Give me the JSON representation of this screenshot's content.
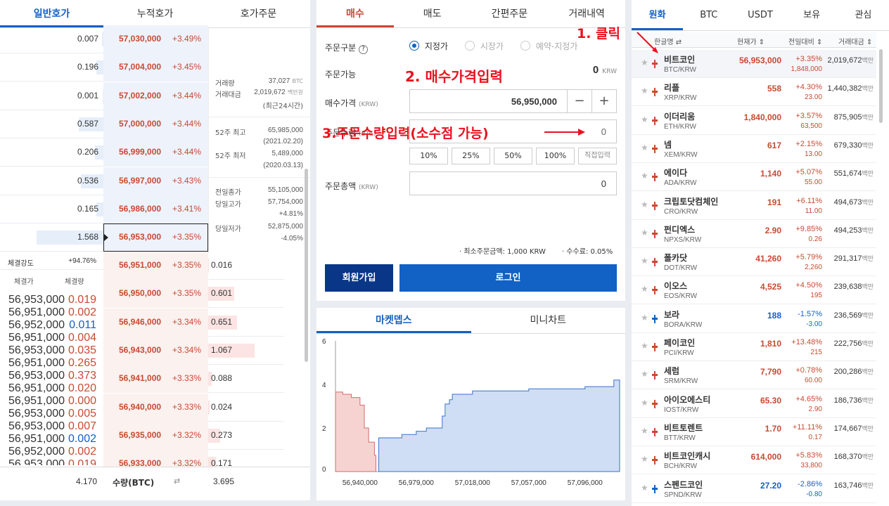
{
  "orderbook": {
    "tabs": [
      "일반호가",
      "누적호가",
      "호가주문"
    ],
    "asks": [
      {
        "qty": "0.007",
        "price": "57,030,000",
        "rate": "+3.49%",
        "bar": 0.02
      },
      {
        "qty": "0.196",
        "price": "57,004,000",
        "rate": "+3.45%",
        "bar": 0.1
      },
      {
        "qty": "0.001",
        "price": "57,002,000",
        "rate": "+3.44%",
        "bar": 0.01
      },
      {
        "qty": "0.587",
        "price": "57,000,000",
        "rate": "+3.44%",
        "bar": 0.35
      },
      {
        "qty": "0.206",
        "price": "56,999,000",
        "rate": "+3.44%",
        "bar": 0.12
      },
      {
        "qty": "0.536",
        "price": "56,997,000",
        "rate": "+3.43%",
        "bar": 0.32
      },
      {
        "qty": "0.165",
        "price": "56,986,000",
        "rate": "+3.41%",
        "bar": 0.1
      },
      {
        "qty": "1.568",
        "price": "56,953,000",
        "rate": "+3.35%",
        "bar": 0.95
      }
    ],
    "bids": [
      {
        "price": "56,951,000",
        "rate": "+3.35%",
        "qty": "0.016",
        "bar": 0.02
      },
      {
        "price": "56,950,000",
        "rate": "+3.35%",
        "qty": "0.601",
        "bar": 0.56
      },
      {
        "price": "56,946,000",
        "rate": "+3.34%",
        "qty": "0.651",
        "bar": 0.62
      },
      {
        "price": "56,943,000",
        "rate": "+3.34%",
        "qty": "1.067",
        "bar": 1.0
      },
      {
        "price": "56,941,000",
        "rate": "+3.33%",
        "qty": "0.088",
        "bar": 0.08
      },
      {
        "price": "56,940,000",
        "rate": "+3.33%",
        "qty": "0.024",
        "bar": 0.03
      },
      {
        "price": "56,935,000",
        "rate": "+3.32%",
        "qty": "0.273",
        "bar": 0.26
      },
      {
        "price": "56,933,000",
        "rate": "+3.32%",
        "qty": "0.171",
        "bar": 0.16
      }
    ],
    "info": {
      "vol_label": "거래량",
      "vol_value": "37,027",
      "vol_unit": "BTC",
      "amt_label": "거래대금",
      "amt_value": "2,019,672",
      "amt_unit": "백만원",
      "period": "(최근24시간)",
      "high52_label": "52주 최고",
      "high52_value": "65,985,000",
      "high52_date": "(2021.02.20)",
      "low52_label": "52주 최저",
      "low52_value": "5,489,000",
      "low52_date": "(2020.03.13)",
      "prev_label": "전일종가",
      "prev_value": "55,105,000",
      "dayhigh_label": "당일고가",
      "dayhigh_value": "57,754,000",
      "dayhigh_rate": "+4.81%",
      "daylow_label": "당일저가",
      "daylow_value": "52,875,000",
      "daylow_rate": "-4.05%"
    },
    "strength_label": "체결강도",
    "strength_value": "+94.76%",
    "trade_head_price": "체결가",
    "trade_head_qty": "체결량",
    "trades": [
      {
        "price": "56,953,000",
        "qty": "0.019",
        "dir": "up"
      },
      {
        "price": "56,951,000",
        "qty": "0.002",
        "dir": "up"
      },
      {
        "price": "56,952,000",
        "qty": "0.011",
        "dir": "down"
      },
      {
        "price": "56,951,000",
        "qty": "0.004",
        "dir": "up"
      },
      {
        "price": "56,953,000",
        "qty": "0.035",
        "dir": "up"
      },
      {
        "price": "56,951,000",
        "qty": "0.265",
        "dir": "up"
      },
      {
        "price": "56,953,000",
        "qty": "0.373",
        "dir": "up"
      },
      {
        "price": "56,951,000",
        "qty": "0.020",
        "dir": "up"
      },
      {
        "price": "56,951,000",
        "qty": "0.000",
        "dir": "up"
      },
      {
        "price": "56,953,000",
        "qty": "0.005",
        "dir": "up"
      },
      {
        "price": "56,953,000",
        "qty": "0.007",
        "dir": "up"
      },
      {
        "price": "56,951,000",
        "qty": "0.002",
        "dir": "down"
      },
      {
        "price": "56,952,000",
        "qty": "0.002",
        "dir": "up"
      },
      {
        "price": "56,953,000",
        "qty": "0.019",
        "dir": "up"
      }
    ],
    "footer_ask_total": "4.170",
    "footer_label": "수량(BTC)",
    "footer_toggle": "⇄",
    "footer_bid_total": "3.695"
  },
  "order_form": {
    "tabs": [
      "매수",
      "매도",
      "간편주문",
      "거래내역"
    ],
    "type_label": "주문구분",
    "help": "?",
    "types": [
      "지정가",
      "시장가",
      "예약-지정가"
    ],
    "available_label": "주문가능",
    "available_value": "0",
    "available_unit": "KRW",
    "price_label": "매수가격",
    "price_unit": "(KRW)",
    "price_value": "56,950,000",
    "minus": "−",
    "plus": "+",
    "qty_label": "주문수량",
    "qty_unit": "(BTC)",
    "qty_value": "0",
    "percents": [
      "10%",
      "25%",
      "50%",
      "100%",
      "직접입력"
    ],
    "total_label": "주문총액",
    "total_unit": "(KRW)",
    "total_value": "0",
    "min_order": "· 최소주문금액: 1,000 KRW",
    "fee": "· 수수료: 0.05%",
    "signup": "회원가입",
    "login": "로그인"
  },
  "depth": {
    "tabs": [
      "마켓뎁스",
      "미니차트"
    ]
  },
  "chart_data": {
    "type": "area",
    "x_ticks": [
      "56,940,000",
      "56,979,000",
      "57,018,000",
      "57,057,000",
      "57,096,000"
    ],
    "y_ticks": [
      "6",
      "4",
      "2",
      "0"
    ],
    "ylim": [
      0,
      6
    ],
    "xlim": [
      56923000,
      57120000
    ],
    "series": [
      {
        "color": "#f6d3d1",
        "stroke": "#d36b6b",
        "x": [
          56923000,
          56928000,
          56928000,
          56934000,
          56934000,
          56940000,
          56940000,
          56943000,
          56943000,
          56946000,
          56946000,
          56950000,
          56950000,
          56951000,
          56951000
        ],
        "y": [
          3.65,
          3.65,
          3.55,
          3.55,
          3.4,
          3.4,
          3.05,
          3.05,
          2.0,
          2.0,
          1.35,
          1.35,
          0.75,
          0.75,
          0
        ]
      },
      {
        "color": "#cfdef4",
        "stroke": "#3a73c9",
        "x": [
          56953000,
          56953000,
          56969000,
          56969000,
          56979000,
          56979000,
          56986000,
          56986000,
          56997000,
          56997000,
          56999000,
          56999000,
          57002000,
          57002000,
          57004000,
          57004000,
          57018000,
          57018000,
          57057000,
          57057000,
          57096000,
          57096000,
          57116000,
          57116000,
          57120000
        ],
        "y": [
          0,
          1.55,
          1.55,
          1.7,
          1.7,
          1.85,
          1.85,
          2.0,
          2.0,
          2.55,
          2.55,
          3.1,
          3.1,
          3.3,
          3.3,
          3.55,
          3.55,
          3.7,
          3.7,
          3.8,
          3.8,
          3.9,
          3.9,
          4.2,
          4.2
        ]
      }
    ]
  },
  "market": {
    "tabs": [
      "원화",
      "BTC",
      "USDT",
      "보유",
      "관심"
    ],
    "head": {
      "name": "한글명 ⇄",
      "price": "현재가 ⇕",
      "change": "전일대비 ⇕",
      "volume": "거래대금 ⇕"
    },
    "coins": [
      {
        "name": "비트코인",
        "sym": "BTC/KRW",
        "price": "56,953,000",
        "rate": "+3.35%",
        "amt": "1,848,000",
        "vol": "2,019,672",
        "unit": "백만",
        "dir": "up"
      },
      {
        "name": "리플",
        "sym": "XRP/KRW",
        "price": "558",
        "rate": "+4.30%",
        "amt": "23.00",
        "vol": "1,440,382",
        "unit": "백만",
        "dir": "up"
      },
      {
        "name": "이더리움",
        "sym": "ETH/KRW",
        "price": "1,840,000",
        "rate": "+3.57%",
        "amt": "63,500",
        "vol": "875,905",
        "unit": "백만",
        "dir": "up"
      },
      {
        "name": "넴",
        "sym": "XEM/KRW",
        "price": "617",
        "rate": "+2.15%",
        "amt": "13.00",
        "vol": "679,330",
        "unit": "백만",
        "dir": "up"
      },
      {
        "name": "에이다",
        "sym": "ADA/KRW",
        "price": "1,140",
        "rate": "+5.07%",
        "amt": "55.00",
        "vol": "551,674",
        "unit": "백만",
        "dir": "up"
      },
      {
        "name": "크립토닷컴체인",
        "sym": "CRO/KRW",
        "price": "191",
        "rate": "+6.11%",
        "amt": "11.00",
        "vol": "494,673",
        "unit": "백만",
        "dir": "up"
      },
      {
        "name": "펀디엑스",
        "sym": "NPXS/KRW",
        "price": "2.90",
        "rate": "+9.85%",
        "amt": "0.26",
        "vol": "494,253",
        "unit": "백만",
        "dir": "up"
      },
      {
        "name": "폴카닷",
        "sym": "DOT/KRW",
        "price": "41,260",
        "rate": "+5.79%",
        "amt": "2,260",
        "vol": "291,317",
        "unit": "백만",
        "dir": "up"
      },
      {
        "name": "이오스",
        "sym": "EOS/KRW",
        "price": "4,525",
        "rate": "+4.50%",
        "amt": "195",
        "vol": "239,638",
        "unit": "백만",
        "dir": "up"
      },
      {
        "name": "보라",
        "sym": "BORA/KRW",
        "price": "188",
        "rate": "-1.57%",
        "amt": "-3.00",
        "vol": "236,569",
        "unit": "백만",
        "dir": "down"
      },
      {
        "name": "페이코인",
        "sym": "PCI/KRW",
        "price": "1,810",
        "rate": "+13.48%",
        "amt": "215",
        "vol": "222,756",
        "unit": "백만",
        "dir": "up"
      },
      {
        "name": "세럼",
        "sym": "SRM/KRW",
        "price": "7,790",
        "rate": "+0.78%",
        "amt": "60.00",
        "vol": "200,286",
        "unit": "백만",
        "dir": "up"
      },
      {
        "name": "아이오에스티",
        "sym": "IOST/KRW",
        "price": "65.30",
        "rate": "+4.65%",
        "amt": "2.90",
        "vol": "186,736",
        "unit": "백만",
        "dir": "up"
      },
      {
        "name": "비트토렌트",
        "sym": "BTT/KRW",
        "price": "1.70",
        "rate": "+11.11%",
        "amt": "0.17",
        "vol": "174,667",
        "unit": "백만",
        "dir": "up"
      },
      {
        "name": "비트코인캐시",
        "sym": "BCH/KRW",
        "price": "614,000",
        "rate": "+5.83%",
        "amt": "33,800",
        "vol": "168,370",
        "unit": "백만",
        "dir": "up"
      },
      {
        "name": "스펜드코인",
        "sym": "SPND/KRW",
        "price": "27.20",
        "rate": "-2.86%",
        "amt": "-0.80",
        "vol": "163,746",
        "unit": "백만",
        "dir": "down"
      }
    ]
  },
  "annotations": {
    "step1": "1. 클릭",
    "step2": "2. 매수가격입력",
    "step3": "3.주문수량입력(소수점 가능)"
  },
  "colors": {
    "up": "#c84a31",
    "down": "#1261c4",
    "brand": "#093687",
    "accent": "#e8131f"
  }
}
